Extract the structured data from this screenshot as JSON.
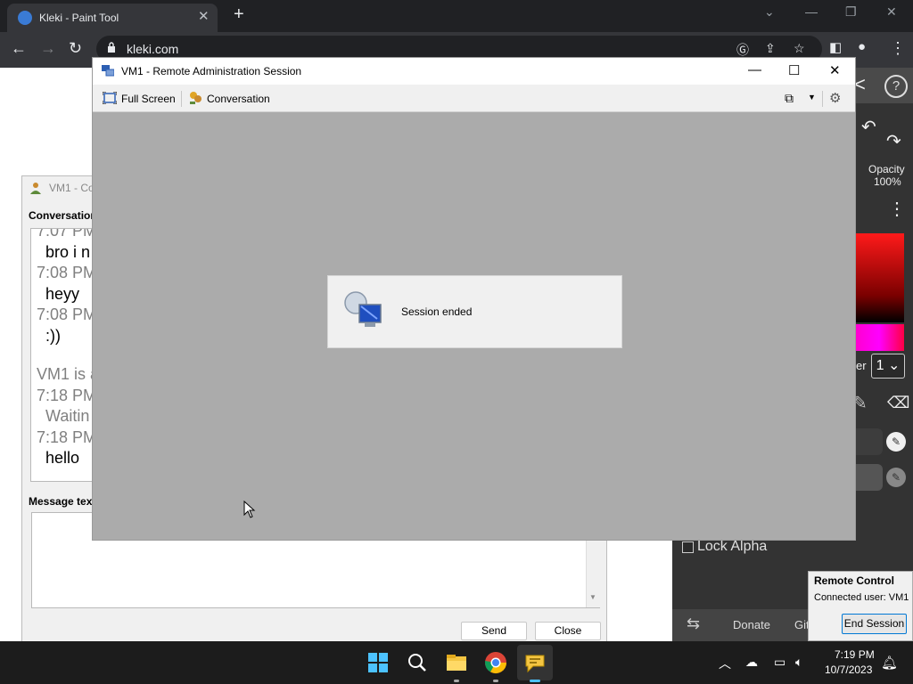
{
  "browser": {
    "tab_title": "Kleki - Paint Tool",
    "url": "kleki.com"
  },
  "kleki": {
    "opacity_label": "Opacity",
    "opacity_value": "100%",
    "layer_value": "1",
    "layer_label_fragment": "er",
    "lock_alpha": "Lock Alpha",
    "donate": "Donate",
    "github": "GitHub"
  },
  "conversation": {
    "title": "VM1 - Co",
    "heading": "Conversation",
    "lines": [
      {
        "kind": "ts",
        "text": "7:07 PM"
      },
      {
        "kind": "msg",
        "text": "bro i n"
      },
      {
        "kind": "ts",
        "text": "7:08 PM"
      },
      {
        "kind": "msg",
        "text": "heyy"
      },
      {
        "kind": "ts",
        "text": "7:08 PM"
      },
      {
        "kind": "msg",
        "text": ":))"
      },
      {
        "kind": "ts",
        "text": "VM1 is a"
      },
      {
        "kind": "ts",
        "text": "7:18 PM"
      },
      {
        "kind": "ts",
        "text": "Waitin"
      },
      {
        "kind": "ts",
        "text": "7:18 PM"
      },
      {
        "kind": "msg",
        "text": "hello"
      }
    ],
    "message_label": "Message tex",
    "send": "Send",
    "close": "Close"
  },
  "remote_session": {
    "title": "VM1 - Remote Administration Session",
    "full_screen": "Full Screen",
    "conversation": "Conversation",
    "dialog_text": "Session ended"
  },
  "remote_control": {
    "title": "Remote Control",
    "user": "Connected user: VM1",
    "end_session": "End Session"
  },
  "taskbar": {
    "time": "7:19 PM",
    "date": "10/7/2023"
  },
  "colors": {
    "chrome_dark": "#202124",
    "chrome_toolbar": "#35363a",
    "session_bg": "#ababab",
    "taskbar": "#1c1c1c",
    "accent": "#0078d4"
  }
}
